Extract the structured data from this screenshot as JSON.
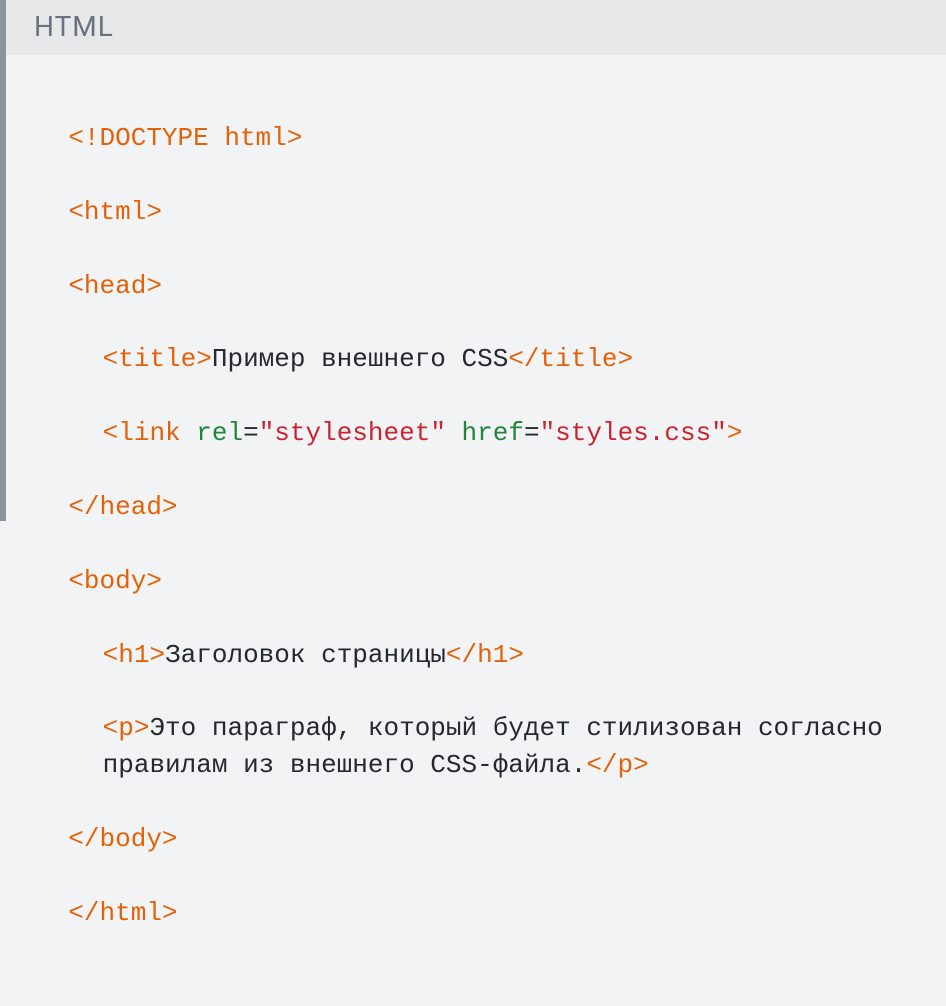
{
  "header": {
    "title": "HTML"
  },
  "code": {
    "doctype_open": "<!DOCTYPE ",
    "doctype_name": "html",
    "doctype_close": ">",
    "html_open": "<html>",
    "head_open": "<head>",
    "title_open": "<title>",
    "title_text": "Пример внешнего CSS",
    "title_close": "</title>",
    "link_open": "<link",
    "rel_attr": "rel",
    "rel_eq": "=",
    "rel_val": "\"stylesheet\"",
    "href_attr": "href",
    "href_eq": "=",
    "href_val": "\"styles.css\"",
    "link_close": ">",
    "head_close": "</head>",
    "body_open": "<body>",
    "h1_open": "<h1>",
    "h1_text": "Заголовок страницы",
    "h1_close": "</h1>",
    "p_open": "<p>",
    "p_text": "Это параграф, который будет стилизован согласно правилам из внешнего CSS-файла.",
    "p_close": "</p>",
    "body_close": "</body>",
    "html_close": "</html>"
  }
}
